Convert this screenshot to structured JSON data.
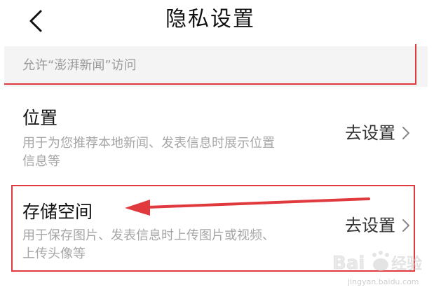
{
  "header": {
    "title": "隐私设置",
    "back_icon": "chevron-left-icon"
  },
  "section": {
    "label": "允许“澎湃新闻”访问"
  },
  "rows": [
    {
      "title": "位置",
      "description_line1": "用于为您推荐本地新闻、发表信息时展示位置",
      "description_line2": "信息等",
      "action": "去设置"
    },
    {
      "title": "存储空间",
      "description_line1": "用于保存图片、发表信息时上传图片或视频、",
      "description_line2": "上传头像等",
      "action": "去设置"
    }
  ],
  "watermark": {
    "brand": "Bai du 经验",
    "url": "jingyan.baidu.com"
  },
  "colors": {
    "annotation_red": "#e0393e",
    "section_bg": "#f4f4f4",
    "title_text": "#111111",
    "desc_text": "#a6a6a6"
  }
}
